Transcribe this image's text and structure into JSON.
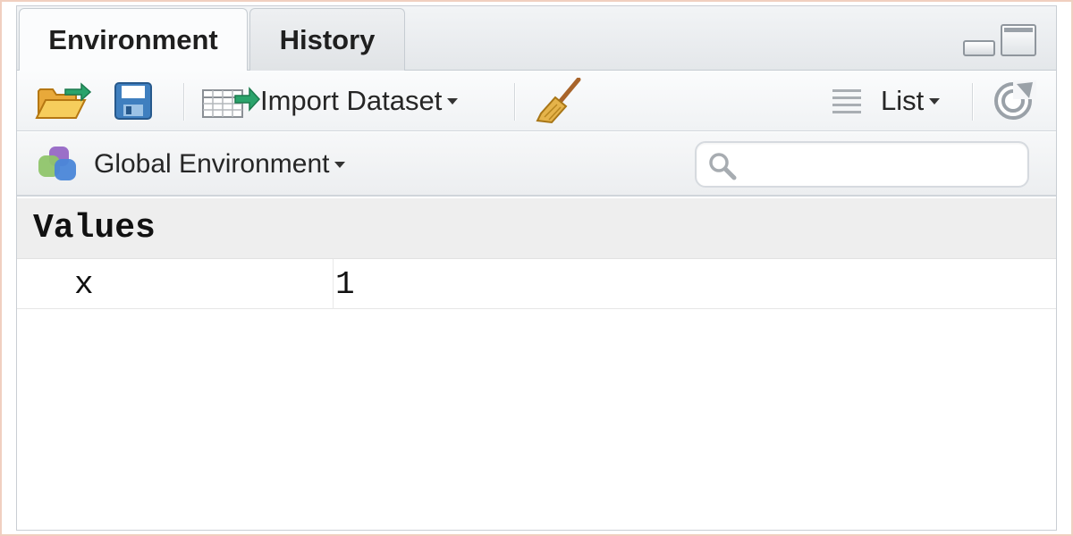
{
  "tabs": [
    {
      "label": "Environment",
      "active": true
    },
    {
      "label": "History",
      "active": false
    }
  ],
  "window_controls": {
    "minimize_icon": "minimize-icon",
    "maximize_icon": "maximize-icon"
  },
  "toolbar": {
    "open_icon": "folder-open-icon",
    "save_icon": "save-icon",
    "import_dataset_label": "Import Dataset",
    "import_icon": "import-dataset-icon",
    "clear_icon": "broom-icon",
    "view_mode_label": "List",
    "view_mode_icon": "list-icon",
    "refresh_icon": "refresh-icon"
  },
  "environment_bar": {
    "selected_environment": "Global Environment",
    "environment_icon": "environment-icon",
    "search": {
      "value": "",
      "placeholder": "",
      "icon": "search-icon"
    }
  },
  "values_section": {
    "header": "Values",
    "rows": [
      {
        "name": "x",
        "value": "1"
      }
    ]
  },
  "colors": {
    "tab_bar_bg": "#e4e7ea",
    "toolbar_bg": "#f0f2f4",
    "section_header_bg": "#eeeeee",
    "import_arrow": "#2aa36b",
    "save_icon": "#3f7fbf"
  }
}
